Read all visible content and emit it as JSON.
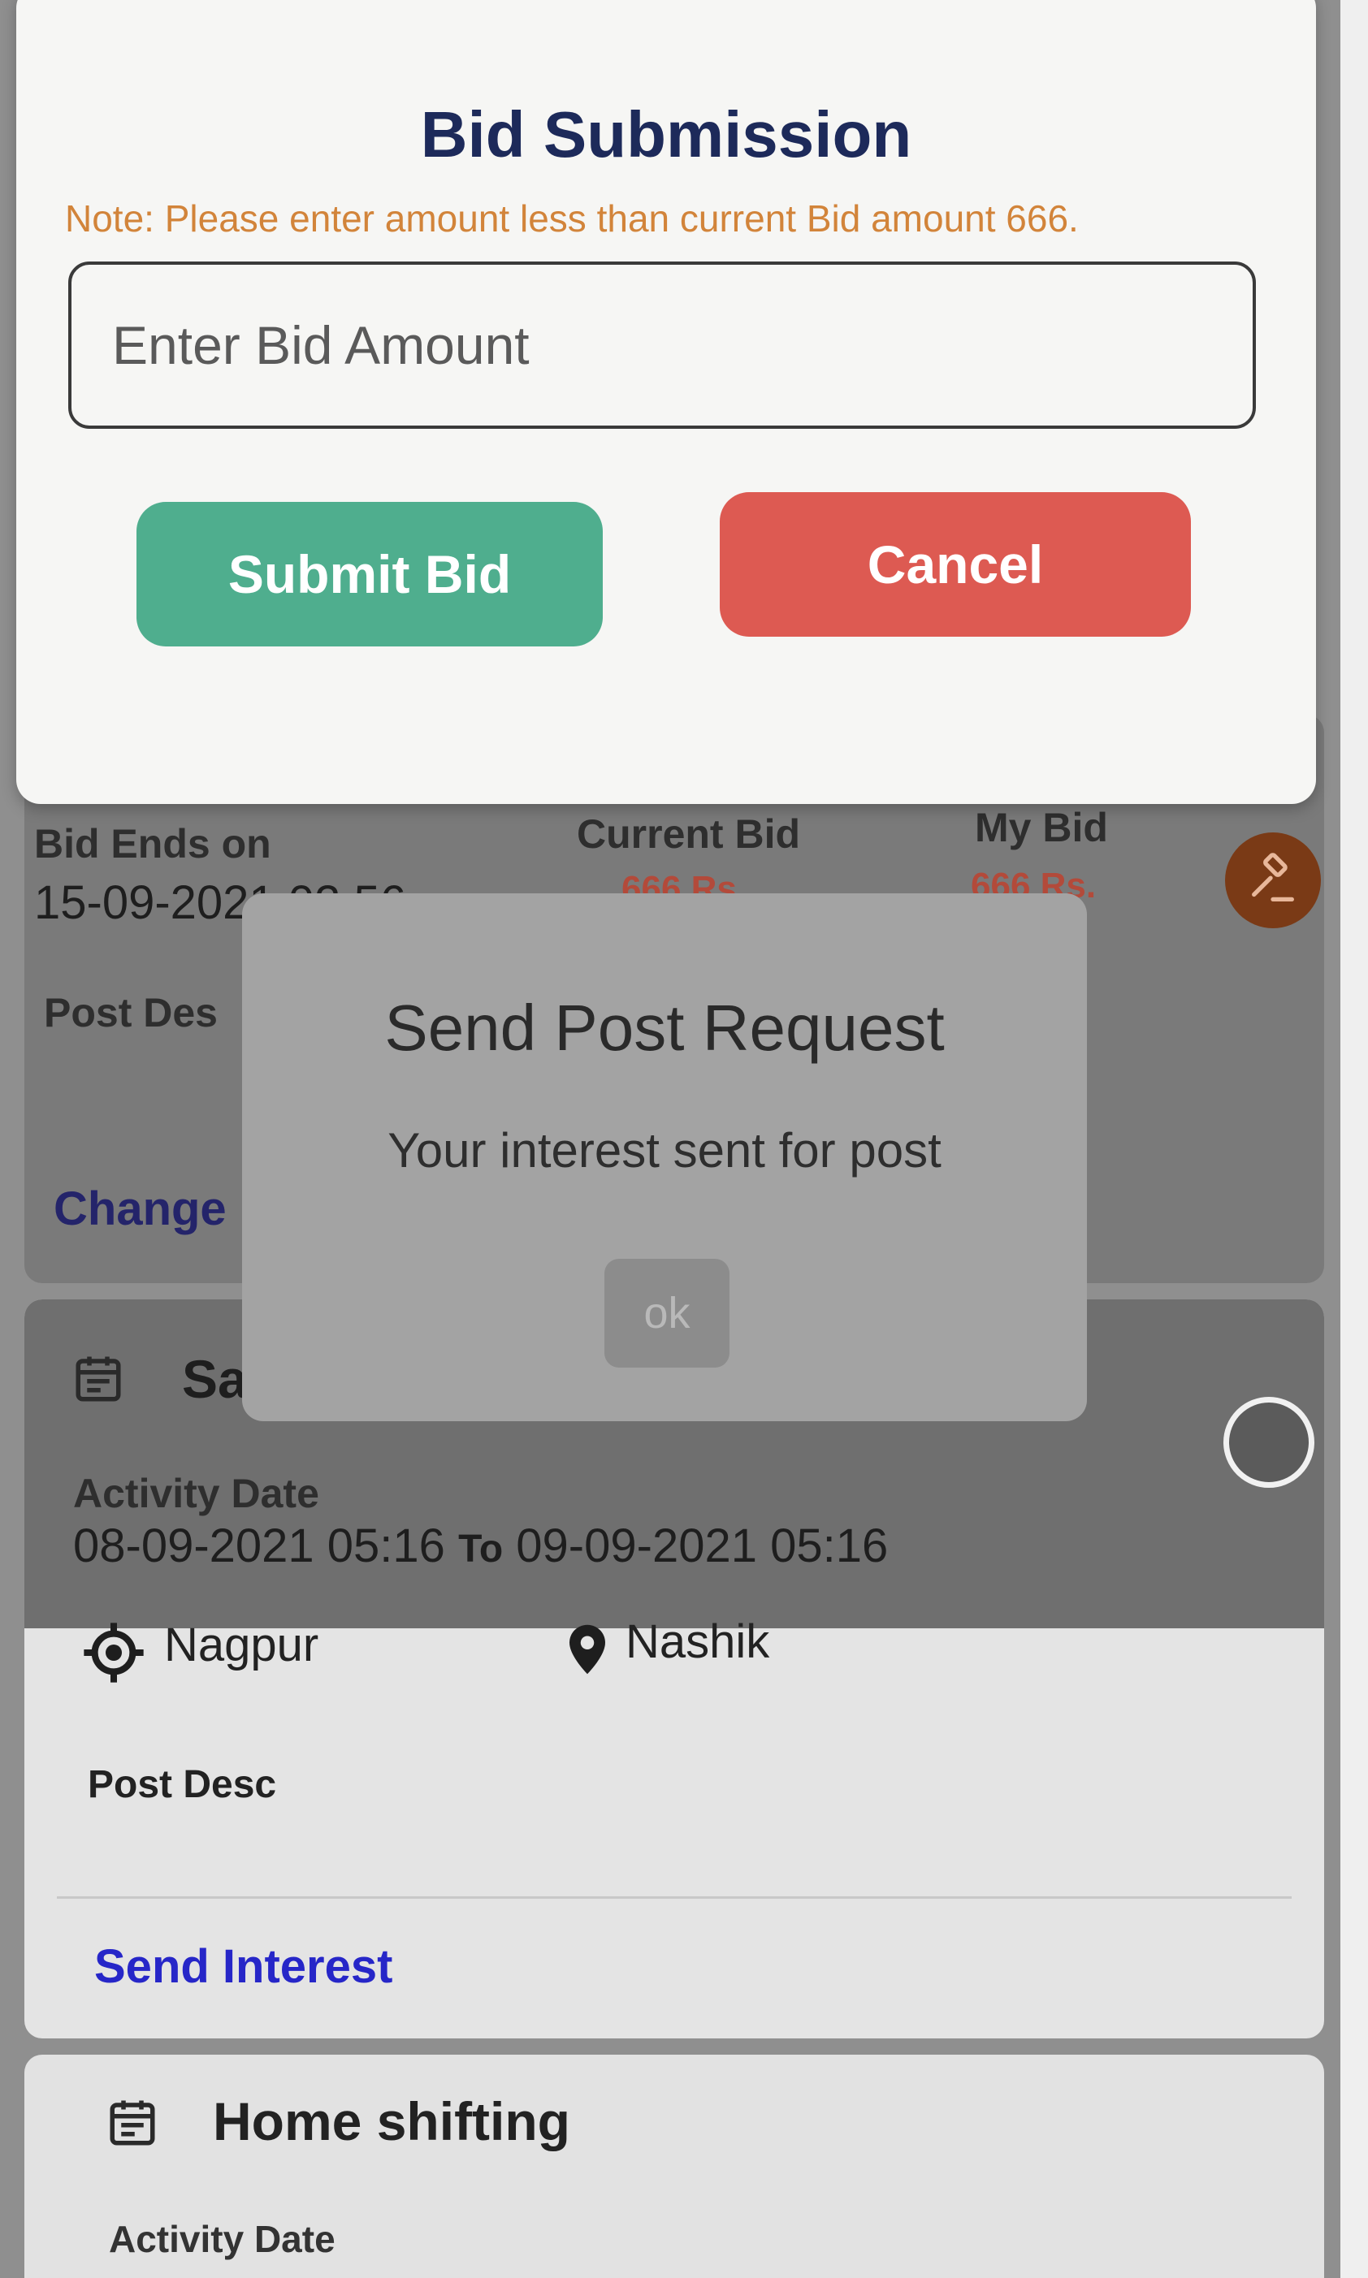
{
  "bid_modal": {
    "title": "Bid Submission",
    "note": "Note: Please enter amount less than current Bid amount 666.",
    "input_placeholder": "Enter Bid Amount",
    "submit_label": "Submit Bid",
    "cancel_label": "Cancel"
  },
  "card1": {
    "bid_ends_label": "Bid Ends on",
    "bid_ends_value": "15-09-2021 02:56",
    "current_bid_label": "Current Bid",
    "current_bid_value": "666 Rs.",
    "my_bid_label": "My Bid",
    "my_bid_value": "666 Rs.",
    "post_desc_label": "Post Des",
    "action_label": "Change"
  },
  "alert": {
    "title": "Send Post Request",
    "message": "Your interest sent for post",
    "ok_label": "ok"
  },
  "card2": {
    "title": "Sa",
    "activity_date_label": "Activity Date",
    "date_from": "08-09-2021 05:16",
    "date_to_word": "To",
    "date_to": "09-09-2021 05:16",
    "origin": "Nagpur",
    "destination": "Nashik",
    "post_desc_label": "Post Desc",
    "action_label": "Send Interest"
  },
  "card3": {
    "title": "Home shifting",
    "activity_date_label": "Activity Date"
  },
  "colors": {
    "submit": "#4fae8e",
    "cancel": "#dd5a52",
    "link": "#2626c8",
    "note": "#d2843a",
    "gavel_bg": "#7a3a16"
  }
}
